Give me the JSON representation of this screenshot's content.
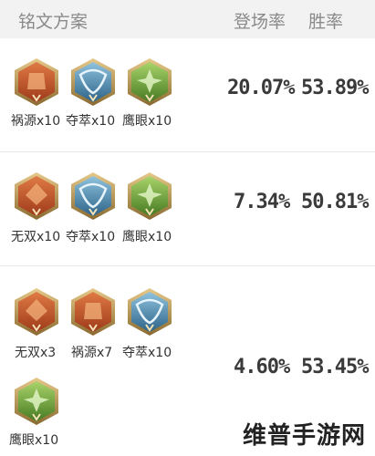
{
  "header": {
    "title": "铭文方案",
    "rate_label": "登场率",
    "win_label": "胜率"
  },
  "colors": {
    "red": "#c4552b",
    "blue": "#3e7fa8",
    "green": "#5f9c35",
    "gold": "#c8a45c"
  },
  "plans": [
    {
      "runes": [
        {
          "icon": "red-rune-icon",
          "label": "祸源x10"
        },
        {
          "icon": "blue-rune-icon",
          "label": "夺萃x10"
        },
        {
          "icon": "green-rune-icon",
          "label": "鹰眼x10"
        }
      ],
      "rate": "20.07%",
      "win": "53.89%"
    },
    {
      "runes": [
        {
          "icon": "red-rune-icon",
          "label": "无双x10"
        },
        {
          "icon": "blue-rune-icon",
          "label": "夺萃x10"
        },
        {
          "icon": "green-rune-icon",
          "label": "鹰眼x10"
        }
      ],
      "rate": "7.34%",
      "win": "50.81%"
    },
    {
      "runes": [
        {
          "icon": "red-rune-icon",
          "label": "无双x3"
        },
        {
          "icon": "red-rune-icon",
          "label": "祸源x7"
        },
        {
          "icon": "blue-rune-icon",
          "label": "夺萃x10"
        },
        {
          "icon": "green-rune-icon",
          "label": "鹰眼x10"
        }
      ],
      "rate": "4.60%",
      "win": "53.45%"
    }
  ],
  "watermark": "维普手游网"
}
